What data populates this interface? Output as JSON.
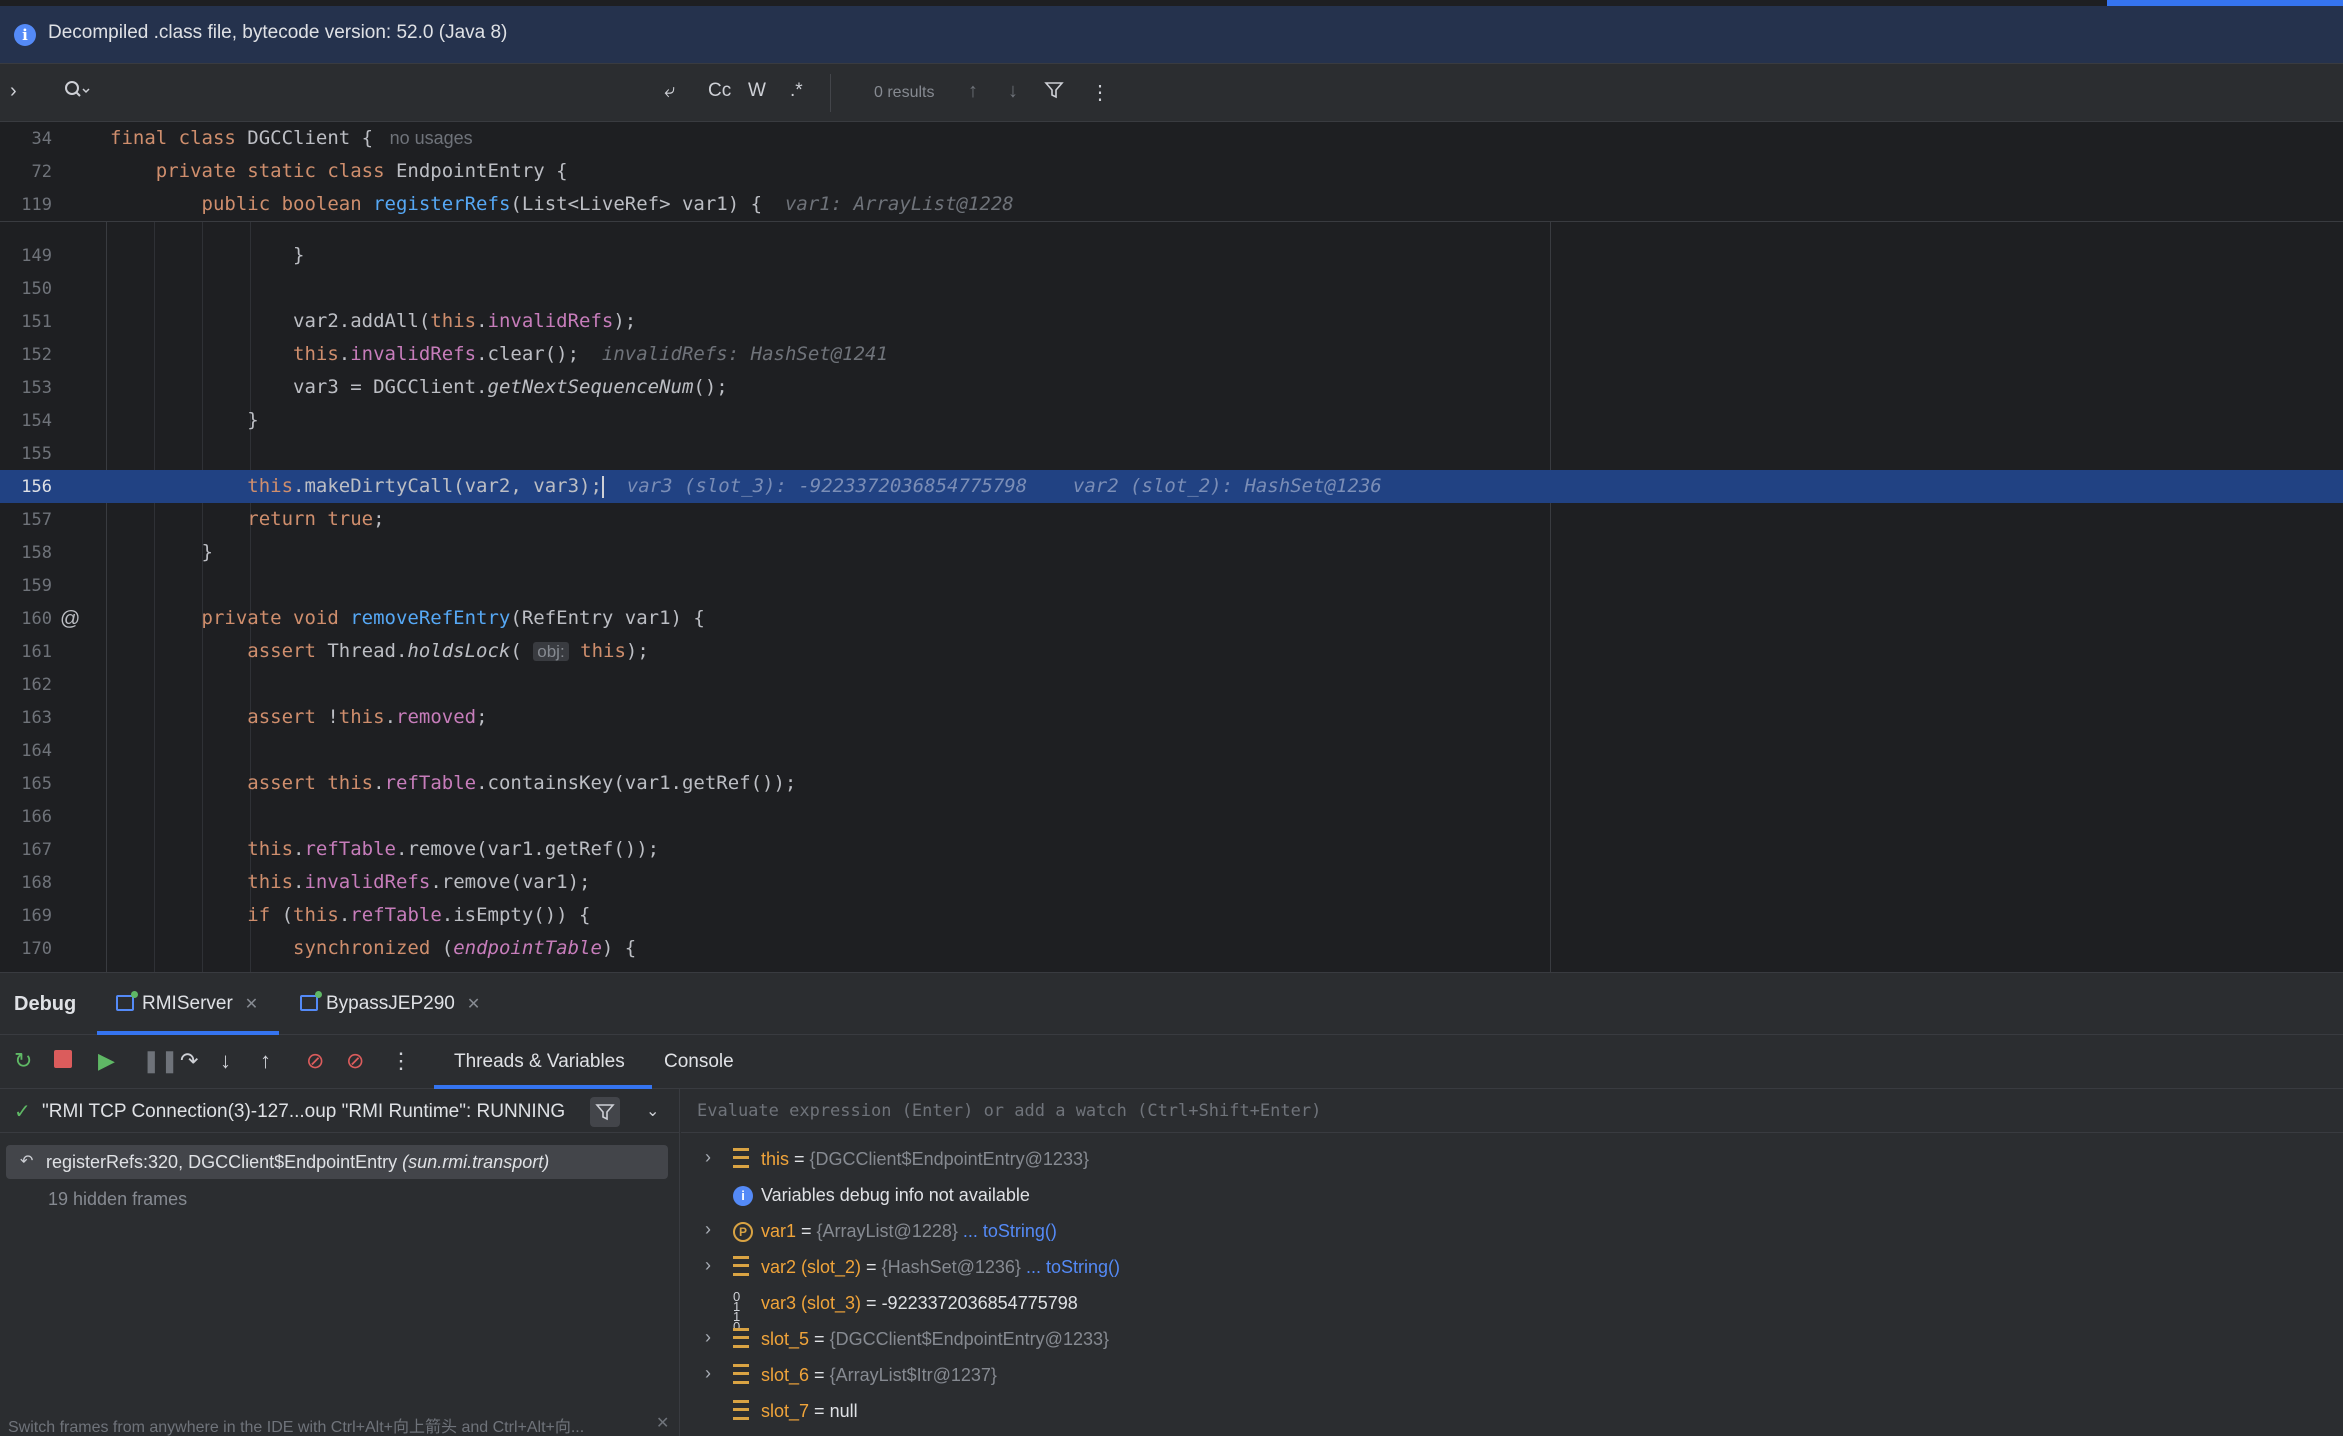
{
  "banner": {
    "text": "Decompiled .class file, bytecode version: 52.0 (Java 8)"
  },
  "findbar": {
    "results": "0 results",
    "cc": "Cc",
    "w": "W",
    "regex": ".*"
  },
  "sticky": [
    {
      "ln": "34",
      "parts": [
        [
          "kw",
          "final class "
        ],
        [
          "",
          "DGCClient { "
        ],
        [
          "muted",
          " no usages"
        ]
      ]
    },
    {
      "ln": "72",
      "parts": [
        [
          "kw",
          "    private static class "
        ],
        [
          "",
          "EndpointEntry {"
        ]
      ]
    },
    {
      "ln": "119",
      "parts": [
        [
          "kw",
          "        public boolean "
        ],
        [
          "fn",
          "registerRefs"
        ],
        [
          "",
          "(List<LiveRef> var1) {  "
        ],
        [
          "hint",
          "var1: ArrayList@1228"
        ]
      ]
    }
  ],
  "lines": [
    {
      "ln": "149",
      "parts": [
        [
          "",
          "                }"
        ]
      ]
    },
    {
      "ln": "150",
      "parts": []
    },
    {
      "ln": "151",
      "parts": [
        [
          "",
          "                var2.addAll("
        ],
        [
          "kw",
          "this"
        ],
        [
          "",
          "."
        ],
        [
          "fld",
          "invalidRefs"
        ],
        [
          "",
          ");"
        ]
      ]
    },
    {
      "ln": "152",
      "parts": [
        [
          "kw",
          "                this"
        ],
        [
          "",
          "."
        ],
        [
          "fld",
          "invalidRefs"
        ],
        [
          "",
          ".clear();  "
        ],
        [
          "hint",
          "invalidRefs: HashSet@1241"
        ]
      ]
    },
    {
      "ln": "153",
      "parts": [
        [
          "",
          "                var3 = DGCClient."
        ],
        [
          "it",
          "getNextSequenceNum"
        ],
        [
          "",
          "();"
        ]
      ]
    },
    {
      "ln": "154",
      "parts": [
        [
          "",
          "            }"
        ]
      ]
    },
    {
      "ln": "155",
      "parts": []
    },
    {
      "ln": "156",
      "exec": true,
      "parts": [
        [
          "kw",
          "            this"
        ],
        [
          "",
          ".makeDirtyCall(var2, var3);"
        ]
      ],
      "hint": "var3 (slot_3): -9223372036854775798    var2 (slot_2): HashSet@1236"
    },
    {
      "ln": "157",
      "parts": [
        [
          "kw",
          "            return true"
        ],
        [
          "",
          ";"
        ]
      ]
    },
    {
      "ln": "158",
      "parts": [
        [
          "",
          "        }"
        ]
      ]
    },
    {
      "ln": "159",
      "parts": []
    },
    {
      "ln": "160",
      "at": true,
      "parts": [
        [
          "kw",
          "        private void "
        ],
        [
          "fn",
          "removeRefEntry"
        ],
        [
          "",
          "(RefEntry var1) {"
        ]
      ]
    },
    {
      "ln": "161",
      "parts": [
        [
          "kw",
          "            assert "
        ],
        [
          "",
          "Thread."
        ],
        [
          "it",
          "holdsLock"
        ],
        [
          "",
          "( "
        ],
        [
          "inlay",
          "obj:"
        ],
        [
          "kw",
          " this"
        ],
        [
          "",
          ");"
        ]
      ]
    },
    {
      "ln": "162",
      "parts": []
    },
    {
      "ln": "163",
      "parts": [
        [
          "kw",
          "            assert "
        ],
        [
          "",
          "!"
        ],
        [
          "kw",
          "this"
        ],
        [
          "",
          "."
        ],
        [
          "fld",
          "removed"
        ],
        [
          "",
          ";"
        ]
      ]
    },
    {
      "ln": "164",
      "parts": []
    },
    {
      "ln": "165",
      "parts": [
        [
          "kw",
          "            assert this"
        ],
        [
          "",
          "."
        ],
        [
          "fld",
          "refTable"
        ],
        [
          "",
          ".containsKey(var1.getRef());"
        ]
      ]
    },
    {
      "ln": "166",
      "parts": []
    },
    {
      "ln": "167",
      "parts": [
        [
          "kw",
          "            this"
        ],
        [
          "",
          "."
        ],
        [
          "fld",
          "refTable"
        ],
        [
          "",
          ".remove(var1.getRef());"
        ]
      ]
    },
    {
      "ln": "168",
      "parts": [
        [
          "kw",
          "            this"
        ],
        [
          "",
          "."
        ],
        [
          "fld",
          "invalidRefs"
        ],
        [
          "",
          ".remove(var1);"
        ]
      ]
    },
    {
      "ln": "169",
      "parts": [
        [
          "kw",
          "            if "
        ],
        [
          "",
          "("
        ],
        [
          "kw",
          "this"
        ],
        [
          "",
          "."
        ],
        [
          "fld",
          "refTable"
        ],
        [
          "",
          ".isEmpty()) {"
        ]
      ]
    },
    {
      "ln": "170",
      "parts": [
        [
          "kw",
          "                synchronized "
        ],
        [
          "",
          "("
        ],
        [
          "fld it",
          "endpointTable"
        ],
        [
          "",
          ") {"
        ]
      ]
    }
  ],
  "debug": {
    "title": "Debug",
    "tabs": [
      {
        "label": "RMIServer"
      },
      {
        "label": "BypassJEP290"
      }
    ],
    "subtabs": {
      "threads": "Threads & Variables",
      "console": "Console"
    },
    "thread": "\"RMI TCP Connection(3)-127...oup \"RMI Runtime\": RUNNING",
    "frame": {
      "method": "registerRefs:320, DGCClient$EndpointEntry ",
      "pkg": "(sun.rmi.transport)"
    },
    "hidden": "19 hidden frames",
    "hint": "Switch frames from anywhere in the IDE with Ctrl+Alt+向上箭头 and Ctrl+Alt+向...",
    "eval_placeholder": "Evaluate expression (Enter) or add a watch (Ctrl+Shift+Enter)",
    "vars": [
      {
        "icon": "stack",
        "expand": true,
        "name": "this",
        "eq": " = ",
        "val": "{DGCClient$EndpointEntry@1233}",
        "grey": true
      },
      {
        "icon": "info",
        "expand": false,
        "name": "",
        "eq": "",
        "val": "Variables debug info not available",
        "grey": false
      },
      {
        "icon": "p",
        "expand": true,
        "name": "var1",
        "eq": " = ",
        "val": "{ArrayList@1228}",
        "grey": true,
        "link": " ... toString()"
      },
      {
        "icon": "stack",
        "expand": true,
        "name": "var2 (slot_2)",
        "eq": " = ",
        "val": "{HashSet@1236}",
        "grey": true,
        "link": " ... toString()"
      },
      {
        "icon": "num",
        "expand": false,
        "name": "var3 (slot_3)",
        "eq": " = ",
        "val": "-9223372036854775798",
        "grey": false
      },
      {
        "icon": "stack",
        "expand": true,
        "name": "slot_5",
        "eq": " = ",
        "val": "{DGCClient$EndpointEntry@1233}",
        "grey": true
      },
      {
        "icon": "stack",
        "expand": true,
        "name": "slot_6",
        "eq": " = ",
        "val": "{ArrayList$Itr@1237}",
        "grey": true
      },
      {
        "icon": "stack",
        "expand": false,
        "name": "slot_7",
        "eq": " = ",
        "val": "null",
        "grey": false
      }
    ]
  },
  "colors": {
    "accent": "#3574f0",
    "exec_line": "#214283",
    "keyword": "#cf8e6d",
    "method": "#56a8f5",
    "field": "#c77dbb"
  }
}
